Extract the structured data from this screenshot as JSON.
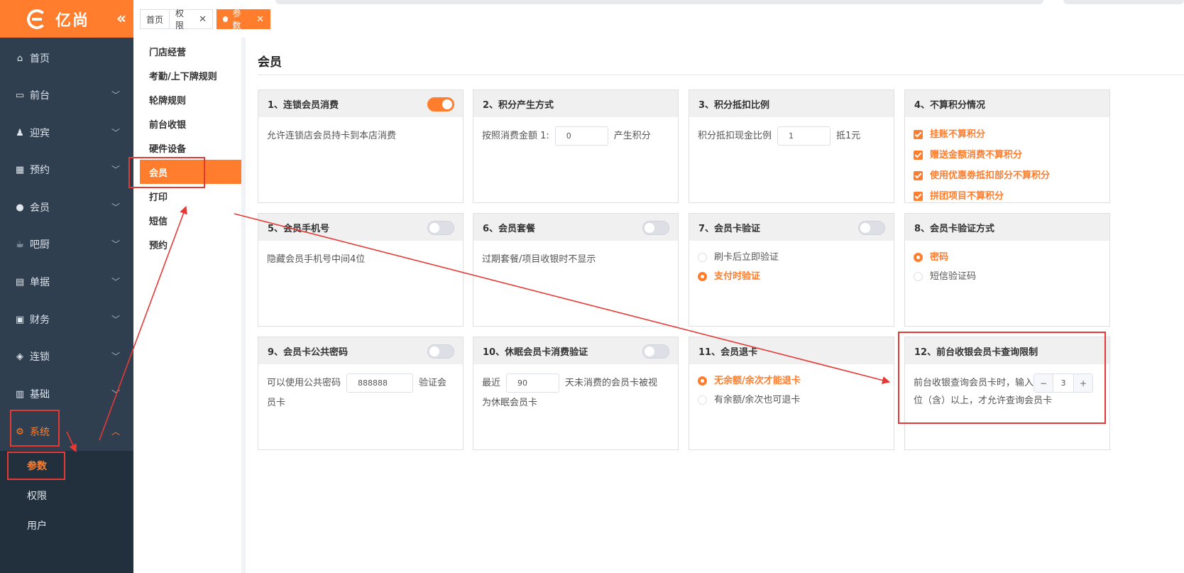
{
  "brand": {
    "name": "亿尚",
    "logo_icon": "e-logo-icon",
    "collapse_icon": "double-chevron-left-icon"
  },
  "sidebar": {
    "items": [
      {
        "label": "首页",
        "icon": "home-icon"
      },
      {
        "label": "前台",
        "icon": "monitor-icon"
      },
      {
        "label": "迎宾",
        "icon": "reception-icon"
      },
      {
        "label": "预约",
        "icon": "calendar-icon"
      },
      {
        "label": "会员",
        "icon": "user-icon"
      },
      {
        "label": "吧厨",
        "icon": "coffee-icon"
      },
      {
        "label": "单据",
        "icon": "document-icon"
      },
      {
        "label": "财务",
        "icon": "finance-icon"
      },
      {
        "label": "连锁",
        "icon": "cube-icon"
      },
      {
        "label": "基础",
        "icon": "grid-icon"
      },
      {
        "label": "系统",
        "icon": "gear-icon"
      }
    ],
    "sub_items": [
      "参数",
      "权限",
      "用户"
    ]
  },
  "tabs": [
    {
      "label": "首页"
    },
    {
      "label": "权限",
      "close": "✕"
    },
    {
      "label": "参数",
      "close": "✕"
    }
  ],
  "submenu": [
    "门店经营",
    "考勤/上下牌规则",
    "轮牌规则",
    "前台收银",
    "硬件设备",
    "会员",
    "打印",
    "短信",
    "预约"
  ],
  "page_title": "会员",
  "cards": {
    "c1": {
      "title": "1、连锁会员消费",
      "toggle": "on",
      "text": "允许连锁店会员持卡到本店消费"
    },
    "c2": {
      "title": "2、积分产生方式",
      "prefix": "按照消费金额 1:",
      "value": "0",
      "suffix": "产生积分"
    },
    "c3": {
      "title": "3、积分抵扣比例",
      "prefix": "积分抵扣现金比例",
      "value": "1",
      "suffix": "抵1元"
    },
    "c4": {
      "title": "4、不算积分情况",
      "options": [
        "挂账不算积分",
        "赠送金额消费不算积分",
        "使用优惠劵抵扣部分不算积分",
        "拼团项目不算积分"
      ]
    },
    "c5": {
      "title": "5、会员手机号",
      "toggle": "off",
      "text": "隐藏会员手机号中间4位"
    },
    "c6": {
      "title": "6、会员套餐",
      "toggle": "off",
      "text": "过期套餐/项目收银时不显示"
    },
    "c7": {
      "title": "7、会员卡验证",
      "toggle": "off",
      "options": [
        "刷卡后立即验证",
        "支付时验证"
      ],
      "selected": "支付时验证"
    },
    "c8": {
      "title": "8、会员卡验证方式",
      "options": [
        "密码",
        "短信验证码"
      ],
      "selected": "密码"
    },
    "c9": {
      "title": "9、会员卡公共密码",
      "toggle": "off",
      "prefix": "可以使用公共密码",
      "value": "888888",
      "suffix_1": "验证会",
      "suffix_2": "员卡"
    },
    "c10": {
      "title": "10、休眠会员卡消费验证",
      "toggle": "off",
      "prefix": "最近",
      "value": "90",
      "suffix_1": "天未消费的会员卡被视",
      "suffix_2": "为休眠会员卡"
    },
    "c11": {
      "title": "11、会员退卡",
      "options": [
        "无余额/余次才能退卡",
        "有余额/余次也可退卡"
      ],
      "selected": "无余额/余次才能退卡"
    },
    "c12": {
      "title": "12、前台收银会员卡查询限制",
      "prefix": "前台收银查询会员卡时，输入",
      "minus": "−",
      "value": "3",
      "plus": "+",
      "suffix": "位（含）以上，才允许查询会员卡"
    }
  },
  "colors": {
    "accent": "#ff7d2c",
    "sidebar_bg": "#2f3f50",
    "annotation": "#e53935"
  }
}
